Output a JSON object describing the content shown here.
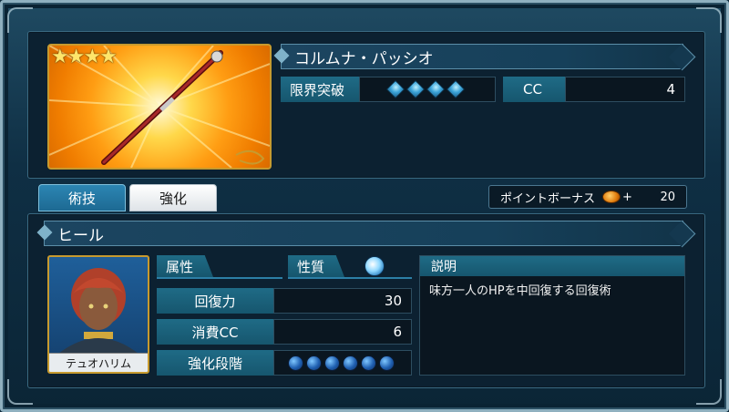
{
  "weapon": {
    "name": "コルムナ・パッシオ",
    "stars": 4,
    "limit_break_label": "限界突破",
    "limit_break_gems": 4,
    "cc_label": "CC",
    "cc_value": "4"
  },
  "tabs": [
    {
      "label": "術技",
      "active": true
    },
    {
      "label": "強化",
      "active": false
    }
  ],
  "point_bonus": {
    "label": "ポイントボーナス",
    "plus": "+",
    "value": "20"
  },
  "skill": {
    "name": "ヒール",
    "character_name": "テュオハリム",
    "attribute_label": "属性",
    "nature_label": "性質",
    "recovery_label": "回復力",
    "recovery_value": "30",
    "cost_label": "消費CC",
    "cost_value": "6",
    "enhance_label": "強化段階",
    "enhance_orbs": 6,
    "description_label": "説明",
    "description_text": "味方一人のHPを中回復する回復術"
  },
  "colors": {
    "accent": "#1f6b86",
    "frame": "#8fb0bf",
    "panel": "#0c2131"
  }
}
